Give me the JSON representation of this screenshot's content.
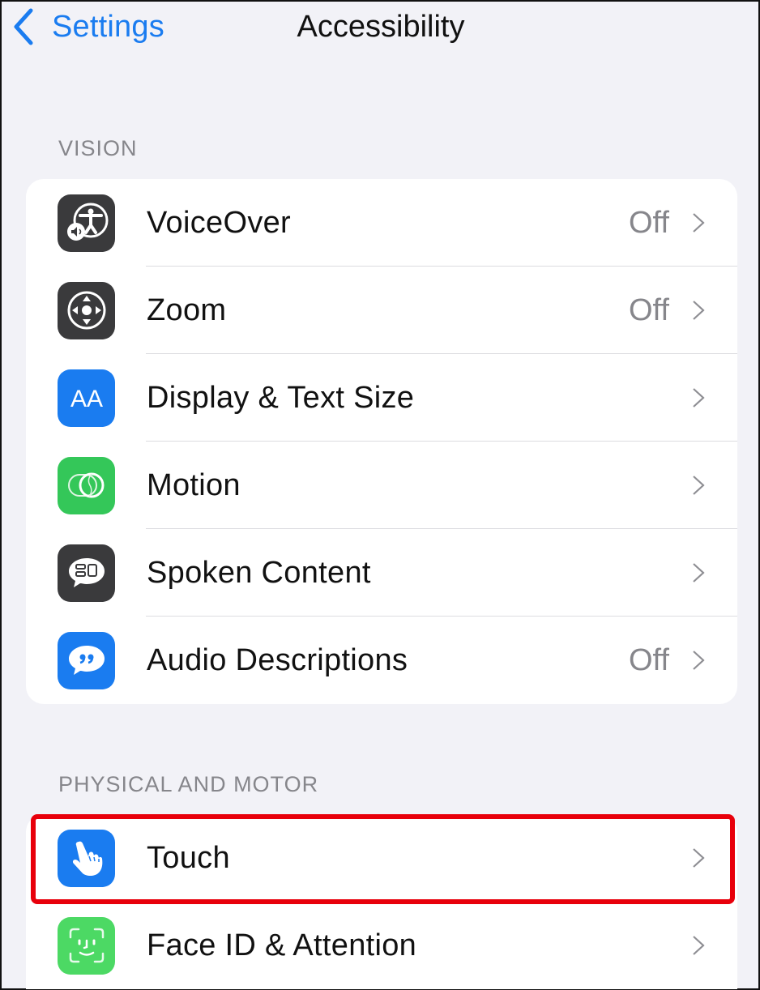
{
  "navbar": {
    "back_label": "Settings",
    "back_icon": "chevron-left-icon",
    "title": "Accessibility"
  },
  "colors": {
    "accent": "#1a7cf0",
    "highlight": "#e8000b",
    "background": "#f2f2f7"
  },
  "sections": [
    {
      "header": "VISION",
      "items": [
        {
          "label": "VoiceOver",
          "value": "Off",
          "icon": "voiceover-icon",
          "icon_color": "#3a3a3c"
        },
        {
          "label": "Zoom",
          "value": "Off",
          "icon": "zoom-icon",
          "icon_color": "#3a3a3c"
        },
        {
          "label": "Display & Text Size",
          "value": "",
          "icon": "text-size-icon",
          "icon_color": "#1a7cf0"
        },
        {
          "label": "Motion",
          "value": "",
          "icon": "motion-icon",
          "icon_color": "#34c759"
        },
        {
          "label": "Spoken Content",
          "value": "",
          "icon": "spoken-content-icon",
          "icon_color": "#3a3a3c"
        },
        {
          "label": "Audio Descriptions",
          "value": "Off",
          "icon": "audio-descriptions-icon",
          "icon_color": "#1a7cf0"
        }
      ]
    },
    {
      "header": "PHYSICAL AND MOTOR",
      "items": [
        {
          "label": "Touch",
          "value": "",
          "icon": "touch-icon",
          "icon_color": "#1a7cf0",
          "highlighted": true
        },
        {
          "label": "Face ID & Attention",
          "value": "",
          "icon": "face-id-icon",
          "icon_color": "#4cd964"
        }
      ]
    }
  ]
}
